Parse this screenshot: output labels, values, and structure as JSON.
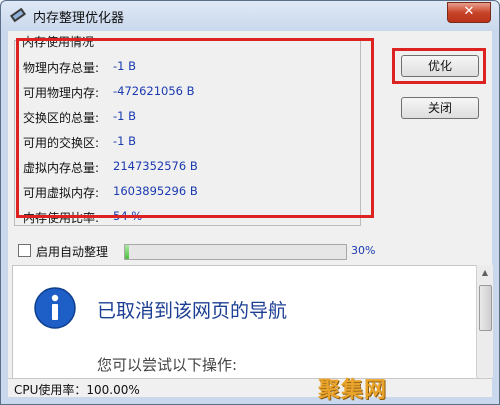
{
  "window": {
    "title": "内存整理优化器",
    "close_glyph": "✕"
  },
  "memory_group": {
    "title": "内存使用情况",
    "rows": [
      {
        "label": "物理内存总量:",
        "value": "-1 B"
      },
      {
        "label": "可用物理内存:",
        "value": "-472621056 B"
      },
      {
        "label": "交换区的总量:",
        "value": "-1 B"
      },
      {
        "label": "可用的交换区:",
        "value": "-1 B"
      },
      {
        "label": "虚拟内存总量:",
        "value": "2147352576 B"
      },
      {
        "label": "可用虚拟内存:",
        "value": "1603895296 B"
      },
      {
        "label": "内存使用比率:",
        "value": "54 %"
      }
    ]
  },
  "buttons": {
    "optimize_label": "优化",
    "close_label": "关闭"
  },
  "auto_clean": {
    "label": "启用自动整理",
    "checked": false
  },
  "progress": {
    "percent": 0.02,
    "text": "30%"
  },
  "browser": {
    "heading": "已取消到该网页的导航",
    "subtext": "您可以尝试以下操作:"
  },
  "status": {
    "text": "CPU使用率：100.00%"
  },
  "watermark": {
    "text": "聚集网"
  },
  "colors": {
    "highlight": "#dd2222",
    "value_text": "#1a3ab0",
    "nav_heading": "#1c3f94"
  },
  "icons": {
    "app": "memory-chip-icon",
    "info": "info-icon"
  }
}
